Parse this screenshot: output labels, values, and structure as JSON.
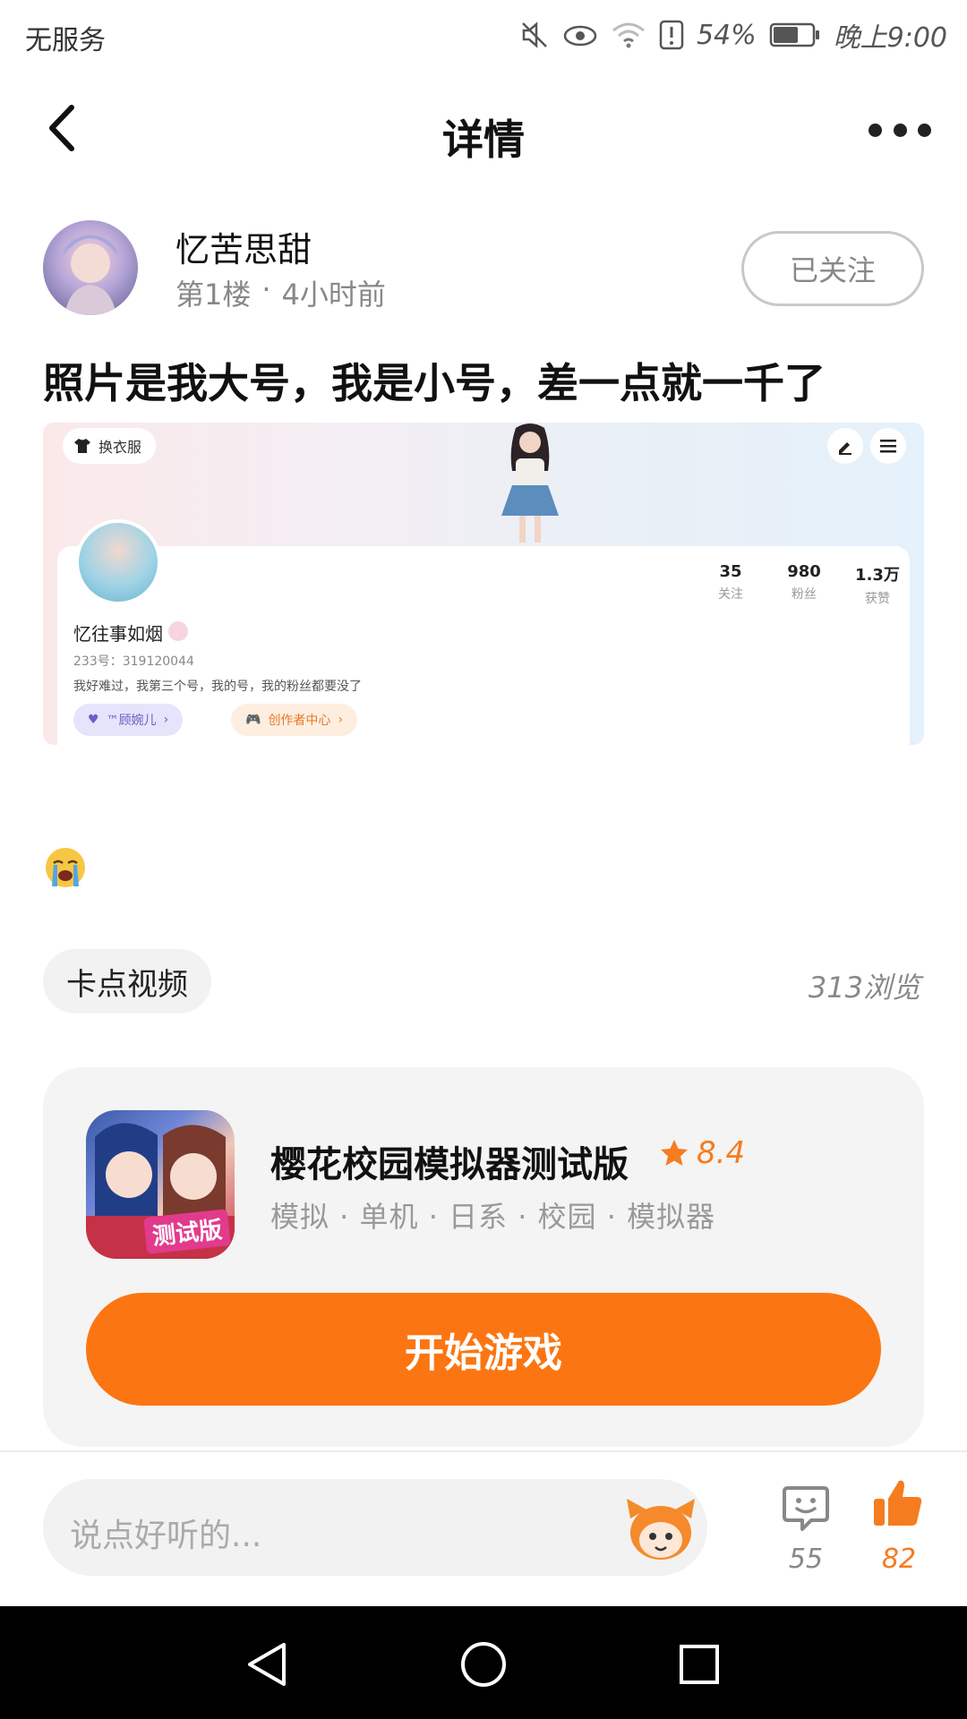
{
  "status_bar": {
    "carrier": "无服务",
    "battery": "54%",
    "time": "晚上9:00"
  },
  "header": {
    "title": "详情"
  },
  "author": {
    "name": "忆苦思甜",
    "floor": "第1楼",
    "time_ago": "4小时前",
    "follow_label": "已关注"
  },
  "post": {
    "text": "照片是我大号，我是小号，差一点就一千了",
    "emoji": "😭"
  },
  "embedded_screenshot": {
    "outfit_button": "换衣服",
    "username": "忆往事如烟",
    "id_line": "233号：319120044",
    "bio": "我好难过，我第三个号，我的号，我的粉丝都要没了",
    "stats": [
      {
        "value": "35",
        "label": "关注"
      },
      {
        "value": "980",
        "label": "粉丝"
      },
      {
        "value": "1.3万",
        "label": "获赞"
      }
    ],
    "chip_left": "™顾婉儿",
    "chip_right": "创作者中心"
  },
  "tag": {
    "label": "卡点视频"
  },
  "views": "313浏览",
  "game": {
    "name": "樱花校园模拟器测试版",
    "rating": "8.4",
    "tags": "模拟 · 单机 · 日系 · 校园 · 模拟器",
    "icon_label": "测试版",
    "play_label": "开始游戏"
  },
  "comment_bar": {
    "placeholder": "说点好听的...",
    "comment_count": "55",
    "like_count": "82"
  },
  "colors": {
    "accent": "#fb7612",
    "like": "#f57c1f",
    "nav_bar": "#000000"
  }
}
